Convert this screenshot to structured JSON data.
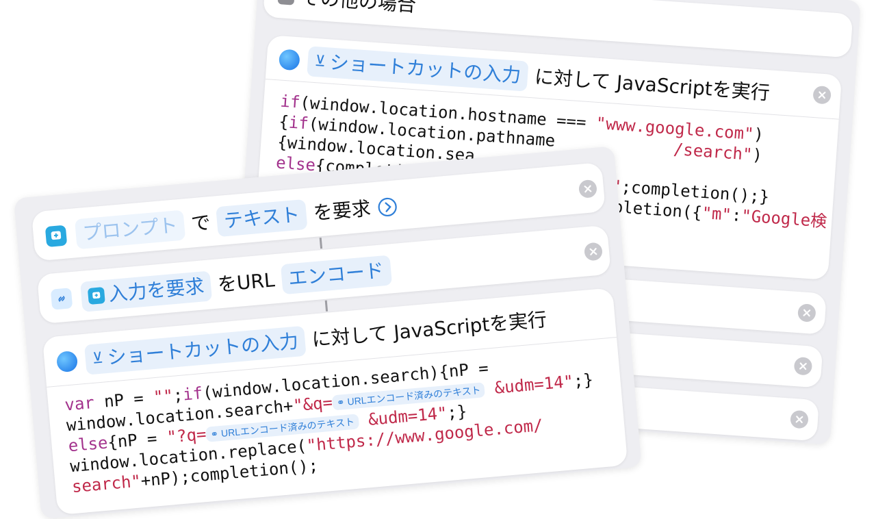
{
  "back_panel": {
    "otherwise_label": "その他の場合",
    "action": {
      "input_token": "ショートカットの入力",
      "suffix": "に対して JavaScriptを実行",
      "code_lines": [
        [
          "if",
          "(window.location.hostname === ",
          "\"www.google.com\"",
          ")"
        ],
        [
          "{if",
          "(window.location.pathname",
          "",
          "\"/search\")"
        ],
        [
          "{window.location.sea",
          "",
          "",
          ""
        ],
        [
          "else",
          "{completi",
          "",
          "\";completion();}"
        ],
        [
          "",
          "",
          "",
          "ompletion({\"m\":\"Google検"
        ]
      ]
    }
  },
  "front_panel": {
    "prompt_action": {
      "prompt_token": "プロンプト",
      "particle": "で",
      "type_token": "テキスト",
      "verb": "を要求"
    },
    "encode_action": {
      "input_token": "入力を要求",
      "middle": "をURL",
      "mode_token": "エンコード"
    },
    "js_action": {
      "input_token": "ショートカットの入力",
      "suffix": "に対して JavaScriptを実行",
      "var_pill": "URLエンコード済みのテキスト"
    }
  },
  "icons": {
    "safari": "safari-icon",
    "prompt": "ask-input-icon",
    "link": "link-icon",
    "close": "close-icon",
    "chevron": "chevron-right-circle-icon",
    "shortcut_input": "shortcut-input-icon"
  }
}
